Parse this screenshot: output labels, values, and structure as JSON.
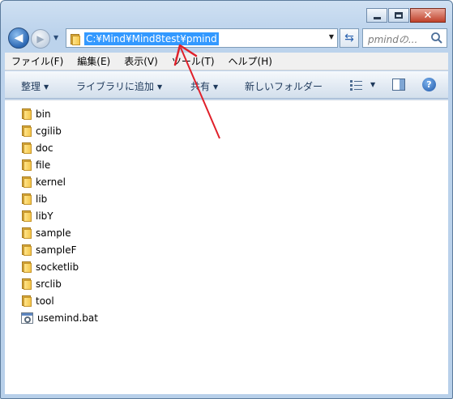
{
  "window": {
    "caption": {
      "minimize_icon": "minimize-icon",
      "maximize_icon": "maximize-icon",
      "close_glyph": "✕"
    }
  },
  "nav": {
    "back_glyph": "◀",
    "forward_glyph": "▶",
    "recent_glyph": "▼",
    "address_path": "C:¥Mind¥Mind8test¥pmind",
    "address_dropdown_glyph": "▼",
    "refresh_glyph": "⇆",
    "search_placeholder": "pmindの..."
  },
  "menu": {
    "items": [
      {
        "label": "ファイル(F)"
      },
      {
        "label": "編集(E)"
      },
      {
        "label": "表示(V)"
      },
      {
        "label": "ツール(T)"
      },
      {
        "label": "ヘルプ(H)"
      }
    ]
  },
  "commands": {
    "organize": "整理",
    "add_to_library": "ライブラリに追加",
    "share": "共有",
    "new_folder": "新しいフォルダー",
    "dropdown_glyph": "▼",
    "help_glyph": "?"
  },
  "files": [
    {
      "name": "bin",
      "type": "folder"
    },
    {
      "name": "cgilib",
      "type": "folder"
    },
    {
      "name": "doc",
      "type": "folder"
    },
    {
      "name": "file",
      "type": "folder"
    },
    {
      "name": "kernel",
      "type": "folder"
    },
    {
      "name": "lib",
      "type": "folder"
    },
    {
      "name": "libY",
      "type": "folder"
    },
    {
      "name": "sample",
      "type": "folder"
    },
    {
      "name": "sampleF",
      "type": "folder"
    },
    {
      "name": "socketlib",
      "type": "folder"
    },
    {
      "name": "srclib",
      "type": "folder"
    },
    {
      "name": "tool",
      "type": "folder"
    },
    {
      "name": "usemind.bat",
      "type": "batch"
    }
  ],
  "colors": {
    "selection": "#3399ff",
    "annotation_arrow": "#e0202a"
  }
}
